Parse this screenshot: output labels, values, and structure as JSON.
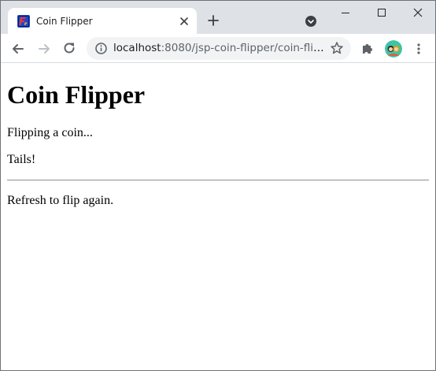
{
  "browser": {
    "tab": {
      "title": "Coin Flipper",
      "favicon": "coin-flipper-favicon"
    },
    "address_bar": {
      "url_host": "localhost",
      "url_path": ":8080/jsp-coin-flipper/coin-flipp...",
      "info_icon": "info-icon",
      "bookmark_icon": "star-icon"
    },
    "icons": {
      "back": "arrow-left-icon",
      "forward": "arrow-right-icon",
      "reload": "reload-icon",
      "new_tab": "plus-icon",
      "tab_search": "tab-search-icon",
      "minimize": "minimize-icon",
      "maximize": "maximize-icon",
      "close": "close-icon",
      "extensions": "puzzle-icon",
      "menu": "kebab-menu-icon"
    },
    "colors": {
      "tabstrip": "#dee1e6",
      "omnibox": "#f1f3f4",
      "favicon_bg": "#1d47c9",
      "favicon_fg": "#e8383a",
      "avatar_bg": "#3dc4a5"
    }
  },
  "page": {
    "heading": "Coin Flipper",
    "status": "Flipping a coin...",
    "result": "Tails!",
    "hint": "Refresh to flip again."
  }
}
